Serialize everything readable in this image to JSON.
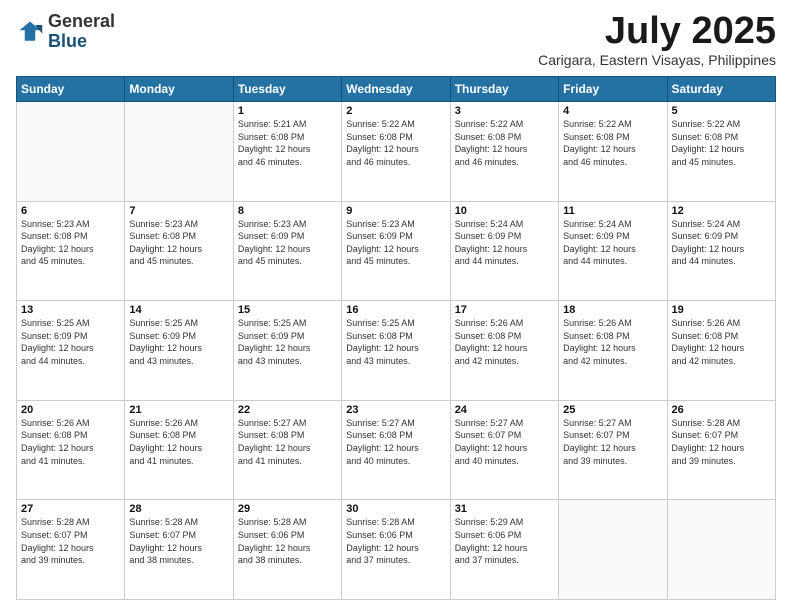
{
  "logo": {
    "general": "General",
    "blue": "Blue"
  },
  "header": {
    "month": "July 2025",
    "location": "Carigara, Eastern Visayas, Philippines"
  },
  "weekdays": [
    "Sunday",
    "Monday",
    "Tuesday",
    "Wednesday",
    "Thursday",
    "Friday",
    "Saturday"
  ],
  "weeks": [
    [
      {
        "day": "",
        "info": ""
      },
      {
        "day": "",
        "info": ""
      },
      {
        "day": "1",
        "sunrise": "5:21 AM",
        "sunset": "6:08 PM",
        "daylight": "12 hours and 46 minutes."
      },
      {
        "day": "2",
        "sunrise": "5:22 AM",
        "sunset": "6:08 PM",
        "daylight": "12 hours and 46 minutes."
      },
      {
        "day": "3",
        "sunrise": "5:22 AM",
        "sunset": "6:08 PM",
        "daylight": "12 hours and 46 minutes."
      },
      {
        "day": "4",
        "sunrise": "5:22 AM",
        "sunset": "6:08 PM",
        "daylight": "12 hours and 46 minutes."
      },
      {
        "day": "5",
        "sunrise": "5:22 AM",
        "sunset": "6:08 PM",
        "daylight": "12 hours and 45 minutes."
      }
    ],
    [
      {
        "day": "6",
        "sunrise": "5:23 AM",
        "sunset": "6:08 PM",
        "daylight": "12 hours and 45 minutes."
      },
      {
        "day": "7",
        "sunrise": "5:23 AM",
        "sunset": "6:08 PM",
        "daylight": "12 hours and 45 minutes."
      },
      {
        "day": "8",
        "sunrise": "5:23 AM",
        "sunset": "6:09 PM",
        "daylight": "12 hours and 45 minutes."
      },
      {
        "day": "9",
        "sunrise": "5:23 AM",
        "sunset": "6:09 PM",
        "daylight": "12 hours and 45 minutes."
      },
      {
        "day": "10",
        "sunrise": "5:24 AM",
        "sunset": "6:09 PM",
        "daylight": "12 hours and 44 minutes."
      },
      {
        "day": "11",
        "sunrise": "5:24 AM",
        "sunset": "6:09 PM",
        "daylight": "12 hours and 44 minutes."
      },
      {
        "day": "12",
        "sunrise": "5:24 AM",
        "sunset": "6:09 PM",
        "daylight": "12 hours and 44 minutes."
      }
    ],
    [
      {
        "day": "13",
        "sunrise": "5:25 AM",
        "sunset": "6:09 PM",
        "daylight": "12 hours and 44 minutes."
      },
      {
        "day": "14",
        "sunrise": "5:25 AM",
        "sunset": "6:09 PM",
        "daylight": "12 hours and 43 minutes."
      },
      {
        "day": "15",
        "sunrise": "5:25 AM",
        "sunset": "6:09 PM",
        "daylight": "12 hours and 43 minutes."
      },
      {
        "day": "16",
        "sunrise": "5:25 AM",
        "sunset": "6:08 PM",
        "daylight": "12 hours and 43 minutes."
      },
      {
        "day": "17",
        "sunrise": "5:26 AM",
        "sunset": "6:08 PM",
        "daylight": "12 hours and 42 minutes."
      },
      {
        "day": "18",
        "sunrise": "5:26 AM",
        "sunset": "6:08 PM",
        "daylight": "12 hours and 42 minutes."
      },
      {
        "day": "19",
        "sunrise": "5:26 AM",
        "sunset": "6:08 PM",
        "daylight": "12 hours and 42 minutes."
      }
    ],
    [
      {
        "day": "20",
        "sunrise": "5:26 AM",
        "sunset": "6:08 PM",
        "daylight": "12 hours and 41 minutes."
      },
      {
        "day": "21",
        "sunrise": "5:26 AM",
        "sunset": "6:08 PM",
        "daylight": "12 hours and 41 minutes."
      },
      {
        "day": "22",
        "sunrise": "5:27 AM",
        "sunset": "6:08 PM",
        "daylight": "12 hours and 41 minutes."
      },
      {
        "day": "23",
        "sunrise": "5:27 AM",
        "sunset": "6:08 PM",
        "daylight": "12 hours and 40 minutes."
      },
      {
        "day": "24",
        "sunrise": "5:27 AM",
        "sunset": "6:07 PM",
        "daylight": "12 hours and 40 minutes."
      },
      {
        "day": "25",
        "sunrise": "5:27 AM",
        "sunset": "6:07 PM",
        "daylight": "12 hours and 39 minutes."
      },
      {
        "day": "26",
        "sunrise": "5:28 AM",
        "sunset": "6:07 PM",
        "daylight": "12 hours and 39 minutes."
      }
    ],
    [
      {
        "day": "27",
        "sunrise": "5:28 AM",
        "sunset": "6:07 PM",
        "daylight": "12 hours and 39 minutes."
      },
      {
        "day": "28",
        "sunrise": "5:28 AM",
        "sunset": "6:07 PM",
        "daylight": "12 hours and 38 minutes."
      },
      {
        "day": "29",
        "sunrise": "5:28 AM",
        "sunset": "6:06 PM",
        "daylight": "12 hours and 38 minutes."
      },
      {
        "day": "30",
        "sunrise": "5:28 AM",
        "sunset": "6:06 PM",
        "daylight": "12 hours and 37 minutes."
      },
      {
        "day": "31",
        "sunrise": "5:29 AM",
        "sunset": "6:06 PM",
        "daylight": "12 hours and 37 minutes."
      },
      {
        "day": "",
        "info": ""
      },
      {
        "day": "",
        "info": ""
      }
    ]
  ]
}
